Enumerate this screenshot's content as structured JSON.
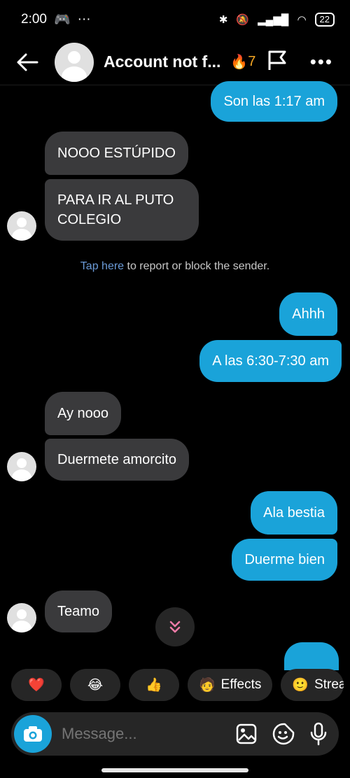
{
  "status_bar": {
    "time": "2:00",
    "dots": "···",
    "battery": "22"
  },
  "header": {
    "title": "Account not f...",
    "streak_count": "7"
  },
  "messages": [
    {
      "dir": "out",
      "text": "Son las 1:17 am"
    },
    {
      "dir": "in",
      "text": "NOOO ESTÚPIDO"
    },
    {
      "dir": "in",
      "text": "PARA IR AL PUTO COLEGIO"
    },
    {
      "dir": "out",
      "text": "Ahhh"
    },
    {
      "dir": "out",
      "text": "A las 6:30-7:30 am"
    },
    {
      "dir": "in",
      "text": "Ay nooo"
    },
    {
      "dir": "in",
      "text": "Duermete amorcito"
    },
    {
      "dir": "out",
      "text": "Ala bestia"
    },
    {
      "dir": "out",
      "text": "Duerme bien"
    },
    {
      "dir": "in",
      "text": "Teamo"
    }
  ],
  "notice": {
    "link": "Tap here",
    "rest": " to report or block the sender."
  },
  "chips": [
    {
      "icon": "heart-emoji",
      "emoji": "❤️",
      "label": ""
    },
    {
      "icon": "laughing-emoji",
      "emoji": "😂",
      "label": ""
    },
    {
      "icon": "thumbs-up-emoji",
      "emoji": "👍",
      "label": ""
    },
    {
      "icon": "effects-icon",
      "emoji": "🧑",
      "label": "Effects"
    },
    {
      "icon": "streaks-icon",
      "emoji": "🙂",
      "label": "Strea"
    }
  ],
  "composer": {
    "placeholder": "Message..."
  },
  "colors": {
    "outgoing": "#1aa3d9",
    "incoming": "#3a3a3c",
    "link": "#6b9bd8"
  }
}
